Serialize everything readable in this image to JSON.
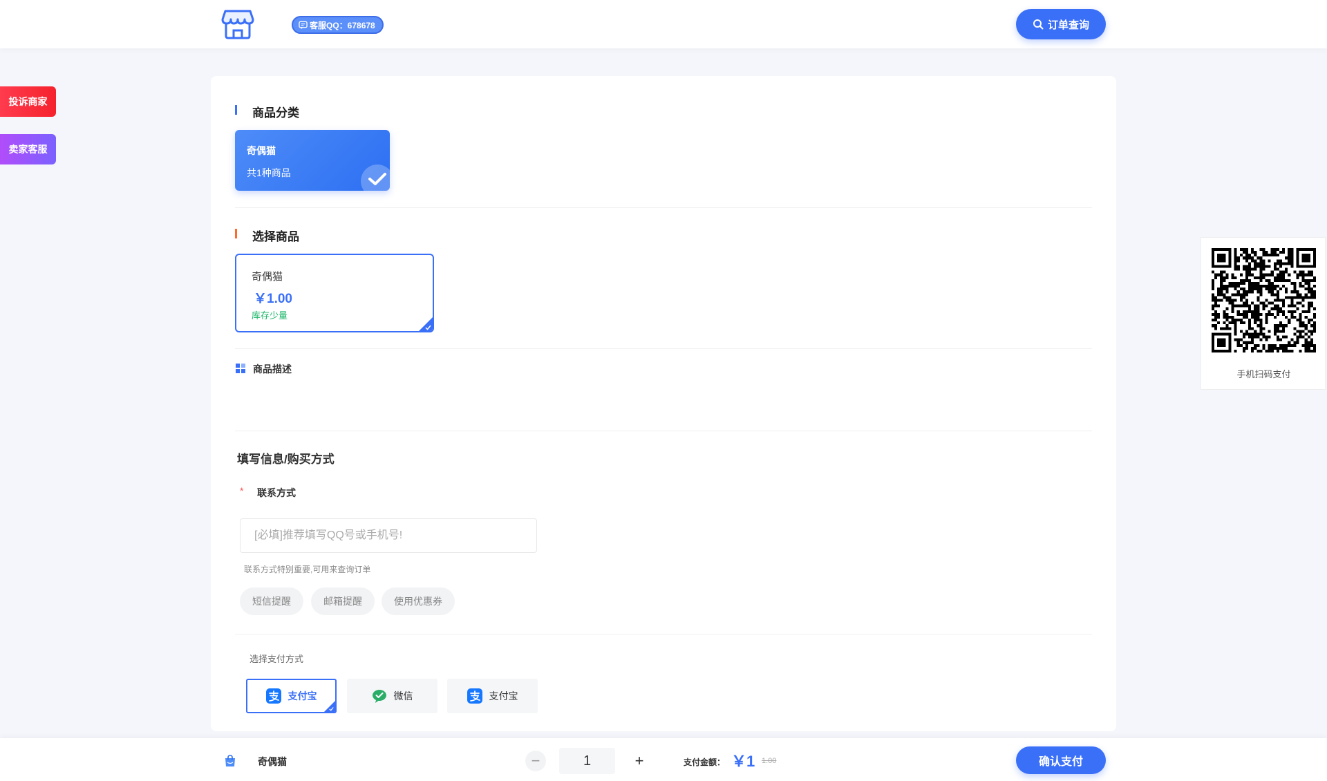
{
  "header": {
    "qq_badge": "客服QQ：678678",
    "order_query_label": "订单查询"
  },
  "side": {
    "complaint_label": "投诉商家",
    "service_label": "卖家客服"
  },
  "qr": {
    "caption": "手机扫码支付"
  },
  "category": {
    "section_title": "商品分类",
    "items": [
      {
        "name": "奇偶猫",
        "count": "共1种商品",
        "selected": true
      }
    ]
  },
  "products": {
    "section_title": "选择商品",
    "items": [
      {
        "name": "奇偶猫",
        "price": "￥1.00",
        "stock": "库存少量",
        "selected": true
      }
    ]
  },
  "description": {
    "title": "商品描述"
  },
  "form": {
    "title": "填写信息/购买方式",
    "required_mark": "*",
    "contact_label": "联系方式",
    "contact_value": "",
    "contact_placeholder": "[必填]推荐填写QQ号或手机号!",
    "contact_hint": "联系方式特别重要,可用来查询订单",
    "options": [
      "短信提醒",
      "邮箱提醒",
      "使用优惠券"
    ]
  },
  "payment": {
    "label": "选择支付方式",
    "methods": [
      {
        "name": "支付宝",
        "icon": "alipay-icon",
        "selected": true
      },
      {
        "name": "微信",
        "icon": "wechat-icon",
        "selected": false
      },
      {
        "name": "支付宝",
        "icon": "alipay-icon",
        "selected": false
      }
    ]
  },
  "bottom": {
    "product_name": "奇偶猫",
    "quantity": "1",
    "minus": "−",
    "plus": "+",
    "amount_label": "支付金额：",
    "amount": "￥1",
    "original_amount": "1.00",
    "confirm_label": "确认支付"
  },
  "colors": {
    "primary": "#3a6ff7",
    "stock_green": "#18b566",
    "complaint_red": "#f5222d",
    "service_purple": "#9a5cfb"
  }
}
